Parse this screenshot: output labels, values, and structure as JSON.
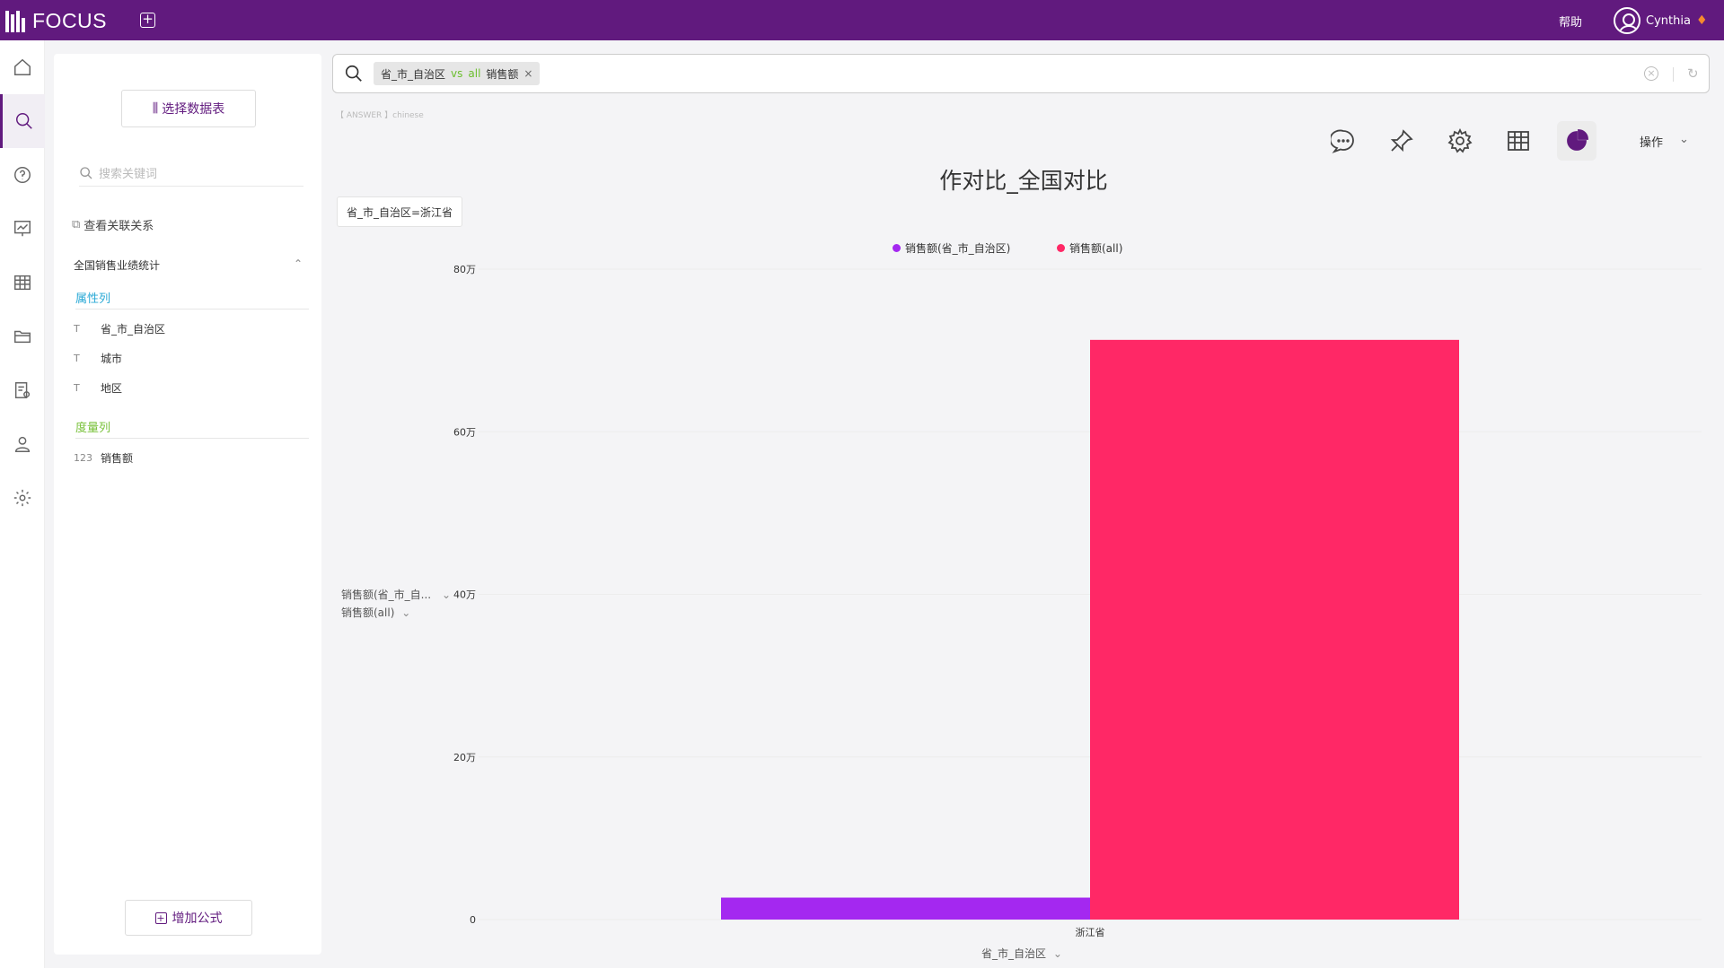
{
  "app": {
    "logo": "FOCUS",
    "help": "帮助",
    "user": "Cynthia"
  },
  "panel": {
    "select_table": "选择数据表",
    "search_placeholder": "搜索关键词",
    "relation": "查看关联关系",
    "dataset": "全国销售业绩统计",
    "attr_label": "属性列",
    "attr_cols": [
      {
        "type": "T",
        "name": "省_市_自治区"
      },
      {
        "type": "T",
        "name": "城市"
      },
      {
        "type": "T",
        "name": "地区"
      }
    ],
    "measure_label": "度量列",
    "measure_cols": [
      {
        "type": "123",
        "name": "销售额"
      }
    ],
    "add_formula": "增加公式"
  },
  "search": {
    "token_a": "省_市_自治区",
    "vs": "vs",
    "all": "all",
    "token_b": "销售额",
    "answer_tag": "【 ANSWER 】chinese"
  },
  "toolbar": {
    "ops": "操作"
  },
  "filter_chip": "省_市_自治区=浙江省",
  "ypicker": {
    "a": "销售额(省_市_自...",
    "b": "销售额(all)"
  },
  "xpicker": "省_市_自治区",
  "chart_data": {
    "type": "bar",
    "title": "作对比_全国对比",
    "categories": [
      "浙江省"
    ],
    "series": [
      {
        "name": "销售额(省_市_自治区)",
        "color": "#a428f0",
        "values": [
          27000
        ]
      },
      {
        "name": "销售额(all)",
        "color": "#ff2866",
        "values": [
          713000
        ]
      }
    ],
    "ylim": [
      0,
      800000
    ],
    "yticks": [
      {
        "value": 0,
        "label": "0"
      },
      {
        "value": 200000,
        "label": "20万"
      },
      {
        "value": 400000,
        "label": "40万"
      },
      {
        "value": 600000,
        "label": "60万"
      },
      {
        "value": 800000,
        "label": "80万"
      }
    ],
    "xlabel": "省_市_自治区",
    "legend": "top",
    "grid": true
  }
}
